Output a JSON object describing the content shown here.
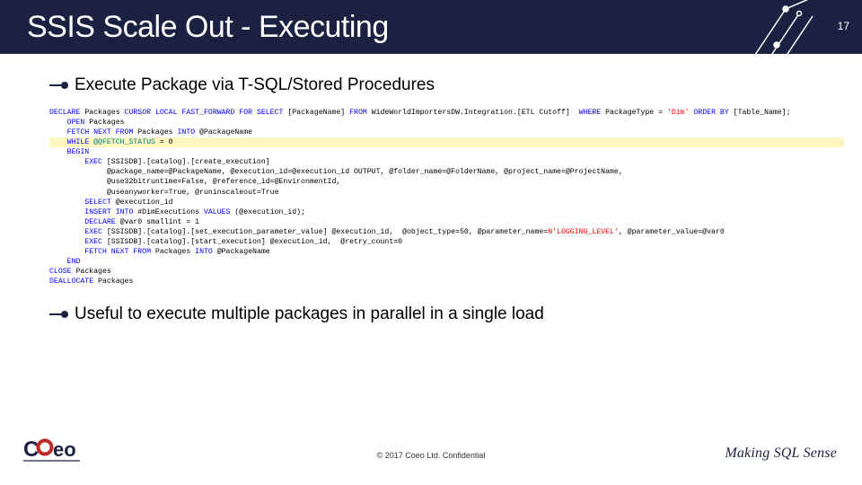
{
  "header": {
    "title": "SSIS Scale Out - Executing",
    "page_number": "17"
  },
  "bullets": {
    "b1": "Execute Package via T-SQL/Stored Procedures",
    "b2": "Useful to execute multiple packages in parallel in a single load"
  },
  "code": {
    "l1a": "DECLARE",
    "l1b": " Packages ",
    "l1c": "CURSOR LOCAL FAST_FORWARD FOR SELECT",
    "l1d": " [PackageName] ",
    "l1e": "FROM",
    "l1f": " WideWorldImportersDW.Integration.[ETL Cutoff]  ",
    "l1g": "WHERE",
    "l1h": " PackageType = ",
    "l1i": "'Dim'",
    "l1j": " ORDER BY",
    "l1k": " [Table_Name];",
    "l2a": "    OPEN",
    "l2b": " Packages",
    "l3a": "    FETCH NEXT FROM",
    "l3b": " Packages ",
    "l3c": "INTO",
    "l3d": " @PackageName",
    "l4a": "    WHILE",
    "l4b": " @@FETCH_STATUS",
    "l4c": " = 0 ",
    "l5a": "    BEGIN",
    "l6a": "        EXEC",
    "l6b": " [SSISDB].[catalog].[create_execution]",
    "l7": "             @package_name=@PackageName, @execution_id=@execution_id OUTPUT, @folder_name=@FolderName, @project_name=@ProjectName,",
    "l8": "             @use32bitruntime=False, @reference_id=@EnvironmentId,",
    "l9": "             @useanyworker=True, @runinscaleout=True",
    "l10a": "        SELECT",
    "l10b": " @execution_id",
    "l11a": "        INSERT INTO",
    "l11b": " #DimExecutions ",
    "l11c": "VALUES",
    "l11d": " (@execution_id);",
    "l12a": "        DECLARE",
    "l12b": " @var0 smallint = 1",
    "l13a": "        EXEC",
    "l13b": " [SSISDB].[catalog].[set_execution_parameter_value] @execution_id,  @object_type=50, @parameter_name=",
    "l13c": "N'LOGGING_LEVEL'",
    "l13d": ", @parameter_value=@var0",
    "l14a": "        EXEC",
    "l14b": " [SSISDB].[catalog].[start_execution] @execution_id,  @retry_count=0",
    "l15a": "        FETCH NEXT FROM",
    "l15b": " Packages ",
    "l15c": "INTO",
    "l15d": " @PackageName",
    "l16a": "    END",
    "l17a": "CLOSE",
    "l17b": " Packages",
    "l18a": "DEALLOCATE",
    "l18b": " Packages"
  },
  "footer": {
    "copyright": "© 2017 Coeo Ltd. Confidential",
    "tagline": "Making SQL Sense",
    "logo_text_c": "C",
    "logo_text_oeo": "oeo"
  },
  "colors": {
    "header_bg": "#1b2141",
    "keyword": "#0000ff",
    "string": "#ff0000",
    "highlight": "#fff7c2"
  }
}
